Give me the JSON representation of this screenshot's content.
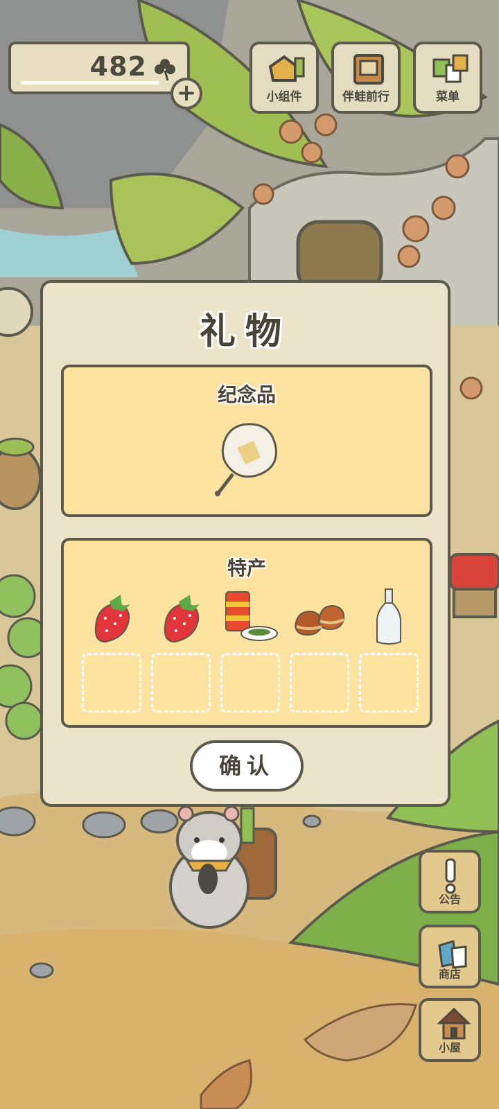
{
  "hud": {
    "clover_count": "482",
    "clover_icon": "clover-icon",
    "add_button_label": "+"
  },
  "top_buttons": [
    {
      "label": "小组件",
      "icon": "widget-icon"
    },
    {
      "label": "伴蛙前行",
      "icon": "journey-book-icon"
    },
    {
      "label": "菜单",
      "icon": "menu-cards-icon"
    }
  ],
  "side_buttons": [
    {
      "label": "公告",
      "icon": "exclamation-icon"
    },
    {
      "label": "商店",
      "icon": "shop-bags-icon"
    },
    {
      "label": "小屋",
      "icon": "house-icon"
    }
  ],
  "modal": {
    "title": "礼物",
    "souvenir_section": {
      "title": "纪念品",
      "items": [
        {
          "icon": "hand-fan-icon"
        }
      ]
    },
    "specialty_section": {
      "title": "特产",
      "items": [
        {
          "icon": "strawberry-icon"
        },
        {
          "icon": "strawberry-icon"
        },
        {
          "icon": "tea-can-icon"
        },
        {
          "icon": "chestnuts-icon"
        },
        {
          "icon": "glass-bottle-icon"
        }
      ],
      "empty_slots": 5
    },
    "confirm_label": "确认"
  },
  "colors": {
    "outline": "#5b5a4d",
    "panel": "#ece4ca",
    "section_fill": "#fde2a0",
    "button_fill": "#e4dcc0"
  }
}
